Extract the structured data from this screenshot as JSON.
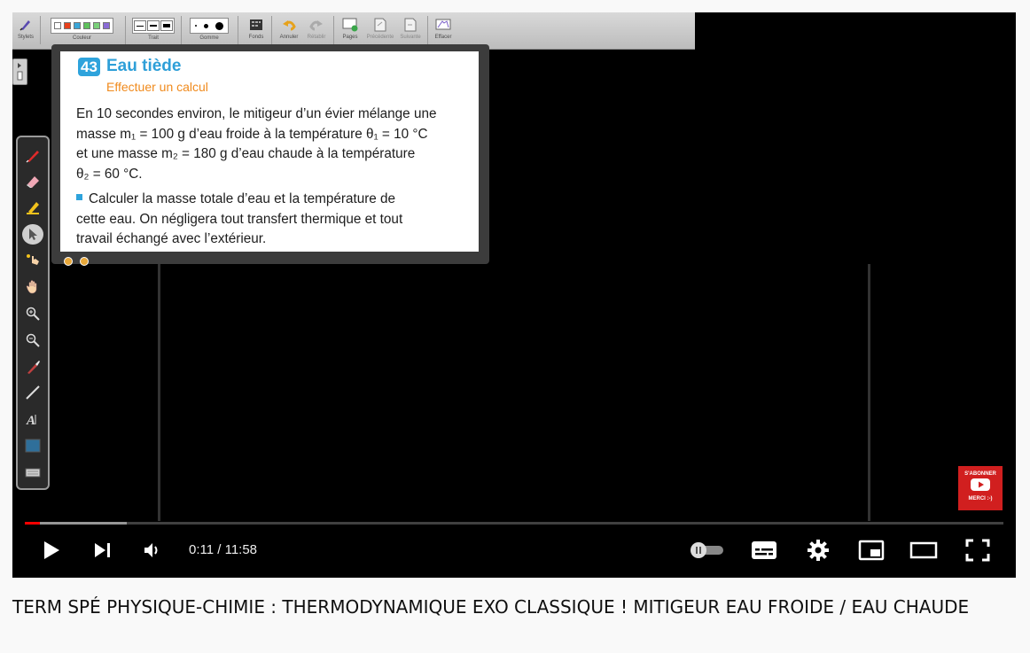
{
  "toolbar": {
    "groups": [
      {
        "id": "stylets",
        "label": "Stylets"
      },
      {
        "id": "couleur",
        "label": "Couleur"
      },
      {
        "id": "trait",
        "label": "Trait"
      },
      {
        "id": "gomme",
        "label": "Gomme"
      },
      {
        "id": "fonds",
        "label": "Fonds"
      },
      {
        "id": "annuler",
        "label": "Annuler"
      },
      {
        "id": "retablir",
        "label": "Rétablir"
      },
      {
        "id": "pages",
        "label": "Pages"
      },
      {
        "id": "precedente",
        "label": "Précédente"
      },
      {
        "id": "suivante",
        "label": "Suivante"
      },
      {
        "id": "effacer",
        "label": "Effacer"
      }
    ],
    "colors": [
      "#ffffff",
      "#e8401c",
      "#3aa6d8",
      "#5fc25c",
      "#5fc25c",
      "#8a6bd6"
    ]
  },
  "side_tools": [
    "pen-icon",
    "eraser-icon",
    "highlighter-icon",
    "pointer-icon",
    "laser-hand-icon",
    "hand-icon",
    "zoom-in-icon",
    "zoom-out-icon",
    "brush-icon",
    "line-icon",
    "text-icon",
    "screen-capture-icon",
    "keyboard-icon"
  ],
  "exercise": {
    "number": "43",
    "title": "Eau tiède",
    "subtitle": "Effectuer un calcul",
    "paragraph_lines": [
      "En 10 secondes environ, le mitigeur d’un évier mélange une",
      "masse m₁ = 100 g d’eau froide à la température θ₁ = 10 °C",
      "et une masse m₂ = 180 g d’eau chaude à la température",
      "θ₂ = 60 °C."
    ],
    "question_lines": [
      "Calculer la masse totale d’eau et la température de",
      "cette eau. On négligera tout transfert thermique et tout",
      "travail échangé avec l’extérieur."
    ]
  },
  "subscribe": {
    "line1": "S'ABONNER",
    "line2": "MERCI :-)"
  },
  "player": {
    "current_time": "0:11",
    "duration": "11:58",
    "time_text": "0:11 / 11:58",
    "progress_played": 0.0153,
    "progress_loaded": 0.104,
    "accent_color": "#ff0000"
  },
  "video": {
    "title": "TERM SPÉ PHYSIQUE-CHIMIE : THERMODYNAMIQUE EXO CLASSIQUE ! MITIGEUR EAU FROIDE / EAU CHAUDE"
  }
}
